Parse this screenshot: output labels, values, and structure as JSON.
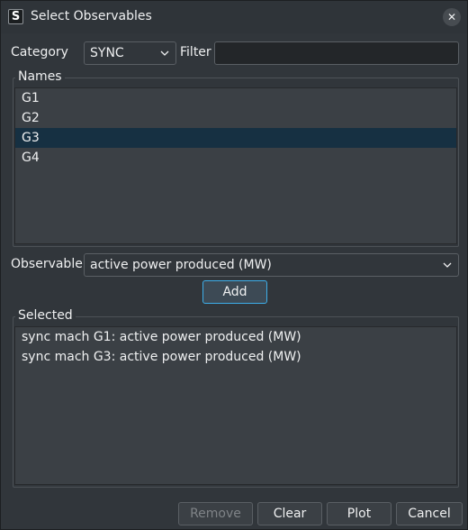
{
  "window": {
    "title": "Select Observables"
  },
  "category": {
    "label": "Category",
    "value": "SYNC"
  },
  "filter": {
    "label": "Filter",
    "value": ""
  },
  "names": {
    "title": "Names",
    "items": [
      "G1",
      "G2",
      "G3",
      "G4"
    ],
    "selected_index": 2
  },
  "observable": {
    "label": "Observable",
    "value": "active power produced (MW)"
  },
  "add_label": "Add",
  "selected": {
    "title": "Selected",
    "items": [
      "sync mach G1: active power produced (MW)",
      "sync mach G3: active power produced (MW)"
    ]
  },
  "buttons": {
    "remove": "Remove",
    "clear": "Clear",
    "plot": "Plot",
    "cancel": "Cancel"
  },
  "colors": {
    "background": "#31363b",
    "selection": "#163042",
    "focus": "#3daee9"
  },
  "icons": {
    "app": "s-logo-icon",
    "close": "close-icon",
    "dropdown": "chevron-down-icon"
  }
}
